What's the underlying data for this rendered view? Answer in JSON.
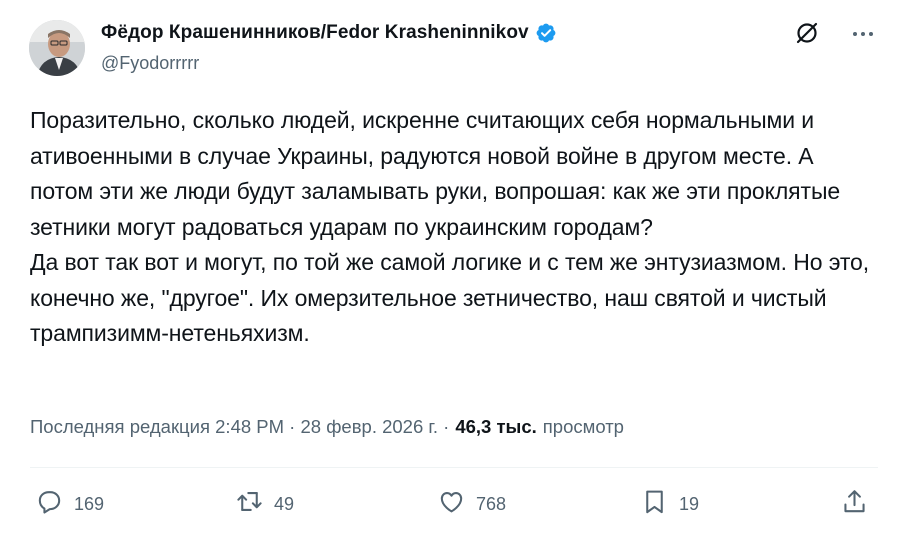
{
  "author": {
    "display_name": "Фёдор Крашенинников/Fedor Krasheninnikov",
    "handle": "@Fyodorrrrr",
    "verified_color": "#1d9bf0"
  },
  "tweet": {
    "text": "Поразительно, сколько людей, искренне считающих себя нормальными и ативоенными в случае Украины, радуются новой войне в другом месте. А потом эти же люди будут заламывать руки, вопрошая: как же эти проклятые зетники могут радоваться ударам по украинским городам?\nДа вот так вот и могут, по той же самой логике и с тем же энтузиазмом. Но это, конечно же, \"другое\". Их омерзительное зетничество, наш святой и чистый трампизимм-нетеньяхизм."
  },
  "meta": {
    "edited_prefix": "Последняя редакция 2:48 PM · 28 февр. 2026 г. ·",
    "views_count": "46,3 тыс.",
    "views_label": "просмотр"
  },
  "actions": {
    "replies": "169",
    "reposts": "49",
    "likes": "768",
    "bookmarks": "19"
  },
  "icons": [
    "grok-icon",
    "more-icon",
    "reply-icon",
    "repost-icon",
    "like-icon",
    "bookmark-icon",
    "share-icon",
    "verified-badge-icon"
  ],
  "colors": {
    "text": "#0f1419",
    "secondary": "#536471",
    "accent": "#1d9bf0"
  }
}
